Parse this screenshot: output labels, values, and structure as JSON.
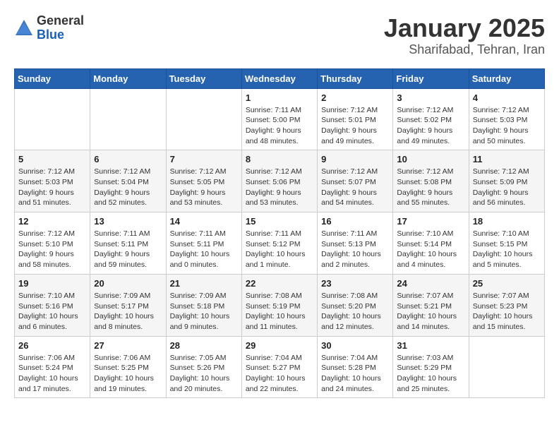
{
  "header": {
    "logo_general": "General",
    "logo_blue": "Blue",
    "title": "January 2025",
    "subtitle": "Sharifabad, Tehran, Iran"
  },
  "calendar": {
    "days_of_week": [
      "Sunday",
      "Monday",
      "Tuesday",
      "Wednesday",
      "Thursday",
      "Friday",
      "Saturday"
    ],
    "weeks": [
      [
        {
          "day": "",
          "info": ""
        },
        {
          "day": "",
          "info": ""
        },
        {
          "day": "",
          "info": ""
        },
        {
          "day": "1",
          "info": "Sunrise: 7:11 AM\nSunset: 5:00 PM\nDaylight: 9 hours\nand 48 minutes."
        },
        {
          "day": "2",
          "info": "Sunrise: 7:12 AM\nSunset: 5:01 PM\nDaylight: 9 hours\nand 49 minutes."
        },
        {
          "day": "3",
          "info": "Sunrise: 7:12 AM\nSunset: 5:02 PM\nDaylight: 9 hours\nand 49 minutes."
        },
        {
          "day": "4",
          "info": "Sunrise: 7:12 AM\nSunset: 5:03 PM\nDaylight: 9 hours\nand 50 minutes."
        }
      ],
      [
        {
          "day": "5",
          "info": "Sunrise: 7:12 AM\nSunset: 5:03 PM\nDaylight: 9 hours\nand 51 minutes."
        },
        {
          "day": "6",
          "info": "Sunrise: 7:12 AM\nSunset: 5:04 PM\nDaylight: 9 hours\nand 52 minutes."
        },
        {
          "day": "7",
          "info": "Sunrise: 7:12 AM\nSunset: 5:05 PM\nDaylight: 9 hours\nand 53 minutes."
        },
        {
          "day": "8",
          "info": "Sunrise: 7:12 AM\nSunset: 5:06 PM\nDaylight: 9 hours\nand 53 minutes."
        },
        {
          "day": "9",
          "info": "Sunrise: 7:12 AM\nSunset: 5:07 PM\nDaylight: 9 hours\nand 54 minutes."
        },
        {
          "day": "10",
          "info": "Sunrise: 7:12 AM\nSunset: 5:08 PM\nDaylight: 9 hours\nand 55 minutes."
        },
        {
          "day": "11",
          "info": "Sunrise: 7:12 AM\nSunset: 5:09 PM\nDaylight: 9 hours\nand 56 minutes."
        }
      ],
      [
        {
          "day": "12",
          "info": "Sunrise: 7:12 AM\nSunset: 5:10 PM\nDaylight: 9 hours\nand 58 minutes."
        },
        {
          "day": "13",
          "info": "Sunrise: 7:11 AM\nSunset: 5:11 PM\nDaylight: 9 hours\nand 59 minutes."
        },
        {
          "day": "14",
          "info": "Sunrise: 7:11 AM\nSunset: 5:11 PM\nDaylight: 10 hours\nand 0 minutes."
        },
        {
          "day": "15",
          "info": "Sunrise: 7:11 AM\nSunset: 5:12 PM\nDaylight: 10 hours\nand 1 minute."
        },
        {
          "day": "16",
          "info": "Sunrise: 7:11 AM\nSunset: 5:13 PM\nDaylight: 10 hours\nand 2 minutes."
        },
        {
          "day": "17",
          "info": "Sunrise: 7:10 AM\nSunset: 5:14 PM\nDaylight: 10 hours\nand 4 minutes."
        },
        {
          "day": "18",
          "info": "Sunrise: 7:10 AM\nSunset: 5:15 PM\nDaylight: 10 hours\nand 5 minutes."
        }
      ],
      [
        {
          "day": "19",
          "info": "Sunrise: 7:10 AM\nSunset: 5:16 PM\nDaylight: 10 hours\nand 6 minutes."
        },
        {
          "day": "20",
          "info": "Sunrise: 7:09 AM\nSunset: 5:17 PM\nDaylight: 10 hours\nand 8 minutes."
        },
        {
          "day": "21",
          "info": "Sunrise: 7:09 AM\nSunset: 5:18 PM\nDaylight: 10 hours\nand 9 minutes."
        },
        {
          "day": "22",
          "info": "Sunrise: 7:08 AM\nSunset: 5:19 PM\nDaylight: 10 hours\nand 11 minutes."
        },
        {
          "day": "23",
          "info": "Sunrise: 7:08 AM\nSunset: 5:20 PM\nDaylight: 10 hours\nand 12 minutes."
        },
        {
          "day": "24",
          "info": "Sunrise: 7:07 AM\nSunset: 5:21 PM\nDaylight: 10 hours\nand 14 minutes."
        },
        {
          "day": "25",
          "info": "Sunrise: 7:07 AM\nSunset: 5:23 PM\nDaylight: 10 hours\nand 15 minutes."
        }
      ],
      [
        {
          "day": "26",
          "info": "Sunrise: 7:06 AM\nSunset: 5:24 PM\nDaylight: 10 hours\nand 17 minutes."
        },
        {
          "day": "27",
          "info": "Sunrise: 7:06 AM\nSunset: 5:25 PM\nDaylight: 10 hours\nand 19 minutes."
        },
        {
          "day": "28",
          "info": "Sunrise: 7:05 AM\nSunset: 5:26 PM\nDaylight: 10 hours\nand 20 minutes."
        },
        {
          "day": "29",
          "info": "Sunrise: 7:04 AM\nSunset: 5:27 PM\nDaylight: 10 hours\nand 22 minutes."
        },
        {
          "day": "30",
          "info": "Sunrise: 7:04 AM\nSunset: 5:28 PM\nDaylight: 10 hours\nand 24 minutes."
        },
        {
          "day": "31",
          "info": "Sunrise: 7:03 AM\nSunset: 5:29 PM\nDaylight: 10 hours\nand 25 minutes."
        },
        {
          "day": "",
          "info": ""
        }
      ]
    ]
  }
}
